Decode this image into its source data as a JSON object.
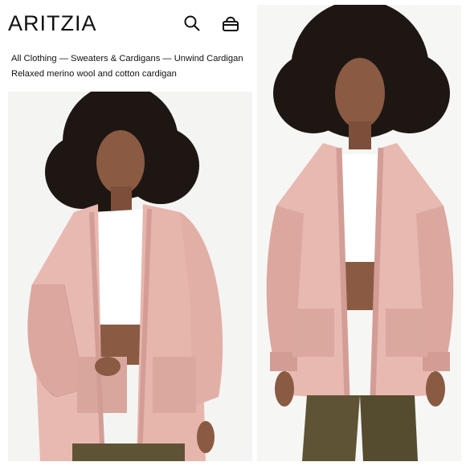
{
  "brand": {
    "logo_text": "ARITZIA"
  },
  "header": {
    "search_icon": "search-icon",
    "bag_icon": "shopping-bag-icon"
  },
  "breadcrumb": {
    "items": [
      "All Clothing",
      "Sweaters & Cardigans",
      "Unwind Cardigan"
    ],
    "separator": "—"
  },
  "product": {
    "subtitle": "Relaxed merino wool and cotton cardigan"
  },
  "colors": {
    "cardigan": "#e8b9b1",
    "cardigan_shadow": "#d39d95",
    "top": "#ffffff",
    "skin": "#8a5a43",
    "hair": "#1e1613",
    "pants": "#5e5435",
    "background": "#f4f4f3"
  }
}
